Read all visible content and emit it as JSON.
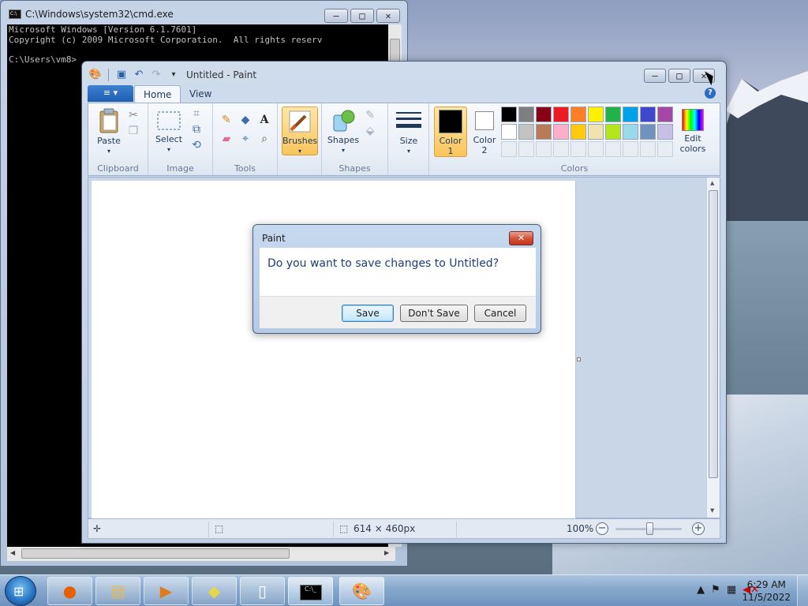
{
  "cmd": {
    "title": "C:\\Windows\\system32\\cmd.exe",
    "icon_text": "C:\\",
    "lines": "Microsoft Windows [Version 6.1.7601]\nCopyright (c) 2009 Microsoft Corporation.  All rights reserv\n\nC:\\Users\\vm8>",
    "buttons": {
      "minimize": "–",
      "maximize": "□",
      "close": "✕"
    }
  },
  "paint": {
    "title": "Untitled - Paint",
    "tabs": {
      "file": "≡ ▾",
      "home": "Home",
      "view": "View"
    },
    "buttons": {
      "minimize": "–",
      "maximize": "□",
      "close": "✕"
    },
    "groups": {
      "clipboard": {
        "label": "Clipboard",
        "paste": "Paste"
      },
      "image": {
        "label": "Image",
        "select": "Select"
      },
      "tools": {
        "label": "Tools"
      },
      "brushes": {
        "label": "Brushes"
      },
      "shapes": {
        "label": "Shapes",
        "shapes_btn": "Shapes"
      },
      "size": {
        "label": "Size"
      },
      "colors": {
        "label": "Colors",
        "color1_a": "Color",
        "color1_b": "1",
        "color2_a": "Color",
        "color2_b": "2",
        "edit_a": "Edit",
        "edit_b": "colors"
      }
    },
    "palette": [
      "#000000",
      "#7f7f7f",
      "#880015",
      "#ed1c24",
      "#ff7f27",
      "#fff200",
      "#22b14c",
      "#00a2e8",
      "#3f48cc",
      "#a349a4",
      "#ffffff",
      "#c3c3c3",
      "#b97a57",
      "#ffaec9",
      "#ffc90e",
      "#efe4b0",
      "#b5e61d",
      "#99d9ea",
      "#7092be",
      "#c8bfe7"
    ],
    "status": {
      "canvas_size": "614 × 460px",
      "zoom": "100%"
    }
  },
  "dialog": {
    "title": "Paint",
    "message": "Do you want to save changes to Untitled?",
    "save": "Save",
    "dont_save": "Don't Save",
    "cancel": "Cancel",
    "close": "✕"
  },
  "taskbar": {
    "time": "6:29 AM",
    "date": "11/5/2022",
    "start_symbol": "⊞"
  }
}
